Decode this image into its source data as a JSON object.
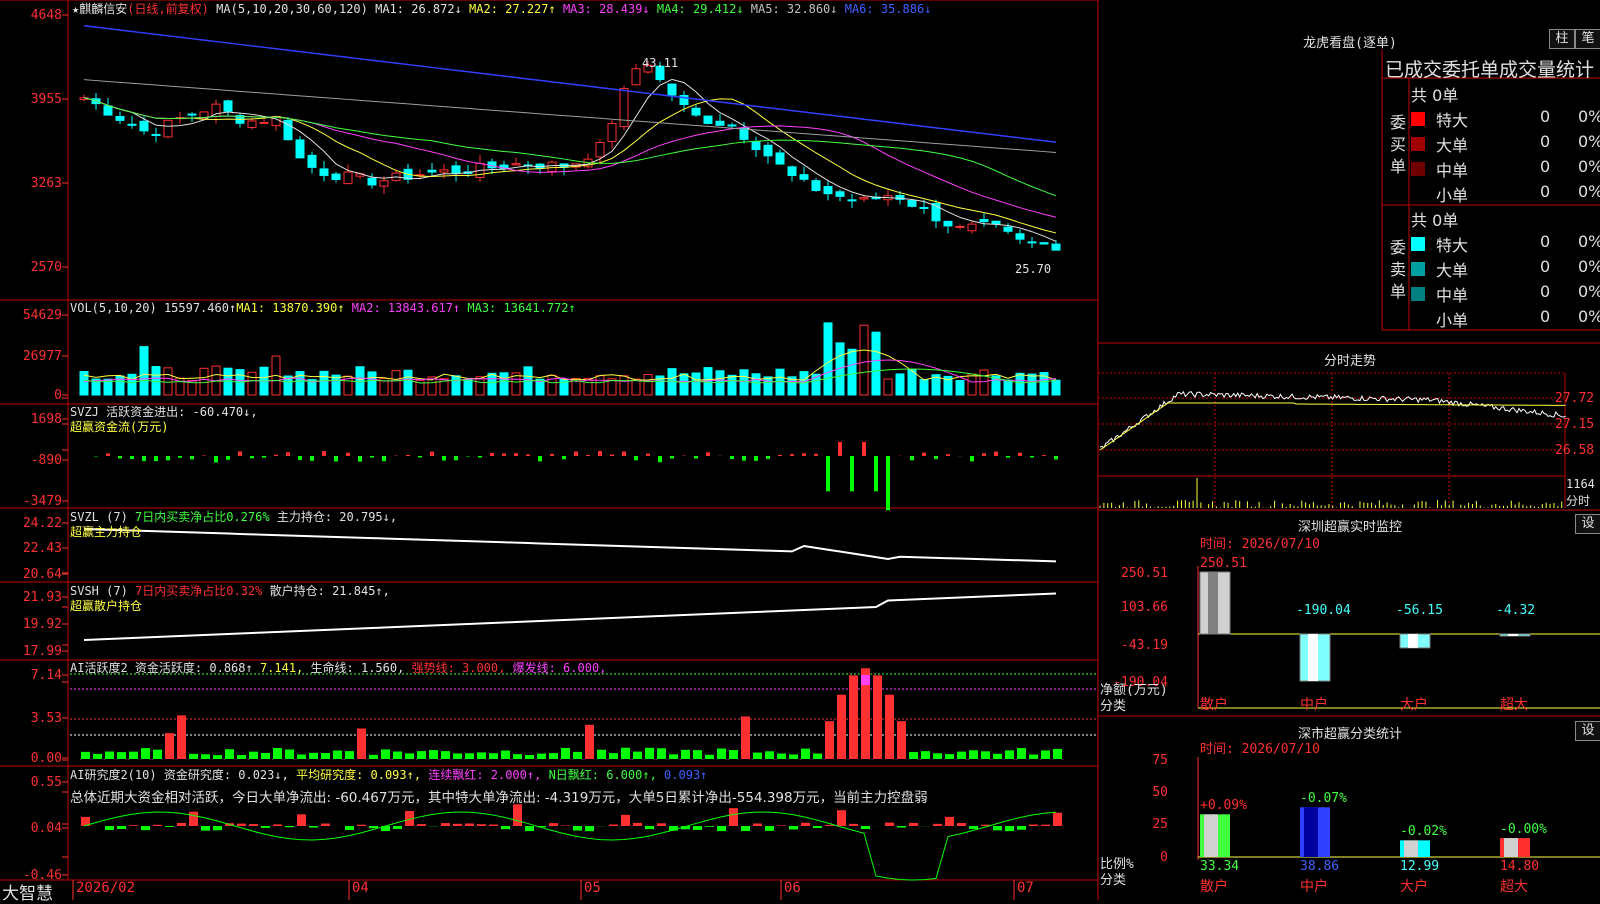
{
  "kline": {
    "title": "★麒麟信安",
    "mode": "(日线,前复权)",
    "ma_label": "MA(5,10,20,30,60,120)",
    "ma": [
      {
        "name": "MA1:",
        "value": "26.872↓",
        "color": "#e0e0e0"
      },
      {
        "name": "MA2:",
        "value": "27.227↑",
        "color": "#ffff40"
      },
      {
        "name": "MA3:",
        "value": "28.439↓",
        "color": "#ff40ff"
      },
      {
        "name": "MA4:",
        "value": "29.412↓",
        "color": "#40ff40"
      },
      {
        "name": "MA5:",
        "value": "32.860↓",
        "color": "#c0c0c0"
      },
      {
        "name": "MA6:",
        "value": "35.886↓",
        "color": "#4060ff"
      }
    ],
    "y_ticks": [
      "4648",
      "3955",
      "3263",
      "2570"
    ],
    "high_label": "43.11",
    "low_label": "25.70"
  },
  "vol": {
    "label": "VOL(5,10,20)",
    "value": "15597.460↑",
    "ma": [
      {
        "name": "MA1:",
        "value": "13870.390↑",
        "color": "#ffff40"
      },
      {
        "name": "MA2:",
        "value": "13843.617↑",
        "color": "#ff40ff"
      },
      {
        "name": "MA3:",
        "value": "13641.772↑",
        "color": "#40ff40"
      }
    ],
    "y_ticks": [
      "54629",
      "26977",
      "0"
    ]
  },
  "svzj": {
    "line1": "SVZJ  活跃资金进出: -60.470↓,",
    "line2": "超赢资金流(万元)",
    "y_ticks": [
      "1698",
      "-890",
      "-3479"
    ]
  },
  "svzl": {
    "label": "SVZL (7)",
    "ratio": "7日内买卖净占比0.276%",
    "hold": "主力持仓: 20.795↓,",
    "sub": "超赢主力持仓",
    "y_ticks": [
      "24.22",
      "22.43",
      "20.64"
    ]
  },
  "svsh": {
    "label": "SVSH (7)",
    "ratio": "7日内买卖净占比0.32%",
    "hold": "散户持仓: 21.845↑,",
    "sub": "超赢散户持仓",
    "y_ticks": [
      "21.93",
      "19.92",
      "17.99"
    ]
  },
  "ai_active": {
    "label": "AI活跃度2",
    "items": [
      {
        "text": "资金活跃度: 0.868↑",
        "color": "#e0e0e0"
      },
      {
        "text": "7.141,",
        "color": "#ffff40"
      },
      {
        "text": "生命线: 1.560,",
        "color": "#e0e0e0"
      },
      {
        "text": "强势线: 3.000,",
        "color": "#ff3030"
      },
      {
        "text": "爆发线: 6.000,",
        "color": "#ff40ff"
      }
    ],
    "y_ticks": [
      "7.14",
      "3.53",
      "0.00"
    ]
  },
  "ai_research": {
    "label": "AI研究度2(10)",
    "items": [
      {
        "text": "资金研究度: 0.023↓,",
        "color": "#e0e0e0"
      },
      {
        "text": "平均研究度: 0.093↑,",
        "color": "#ffff40"
      },
      {
        "text": "连续飘红: 2.000↑,",
        "color": "#ff40ff"
      },
      {
        "text": "N日飘红: 6.000↑,",
        "color": "#40ff40"
      },
      {
        "text": "0.093↑",
        "color": "#4060ff"
      }
    ],
    "summary": "总体近期大资金相对活跃，今日大单净流出: -60.467万元，其中特大单净流出: -4.319万元，大单5日累计净出-554.398万元，当前主力控盘弱",
    "y_ticks": [
      "0.55",
      "0.04",
      "-0.46"
    ]
  },
  "bottom": {
    "brand": "大智慧",
    "dates": [
      "2026/02",
      "04",
      "05",
      "06",
      "07"
    ]
  },
  "dragon": {
    "title": "龙虎看盘(逐单)",
    "btn_bar": "柱",
    "btn_tick": "笔",
    "header": "已成交委托单成交量统计",
    "buy_label": "委买单",
    "sell_label": "委卖单",
    "buy_total": "共 0单",
    "sell_total": "共 0单",
    "buy_rows": [
      {
        "name": "特大",
        "count": "0",
        "pct": "0%",
        "color": "#ff0000"
      },
      {
        "name": "大单",
        "count": "0",
        "pct": "0%",
        "color": "#a00000"
      },
      {
        "name": "中单",
        "count": "0",
        "pct": "0%",
        "color": "#700000"
      },
      {
        "name": "小单",
        "count": "0",
        "pct": "0%",
        "color": ""
      }
    ],
    "sell_rows": [
      {
        "name": "特大",
        "count": "0",
        "pct": "0%",
        "color": "#00ffff"
      },
      {
        "name": "大单",
        "count": "0",
        "pct": "0%",
        "color": "#00a0a0"
      },
      {
        "name": "中单",
        "count": "0",
        "pct": "0%",
        "color": "#008080"
      },
      {
        "name": "小单",
        "count": "0",
        "pct": "0%",
        "color": ""
      }
    ]
  },
  "intraday": {
    "title": "分时走势",
    "y_ticks": [
      "27.72",
      "27.15",
      "26.58"
    ],
    "vol_tick": "1164",
    "vol_label": "分时"
  },
  "monitor": {
    "title": "深圳超赢实时监控",
    "set": "设",
    "time": "时间: 2026/07/10",
    "y_ticks": [
      "250.51",
      "103.66",
      "-43.19",
      "-190.04"
    ],
    "y_label": "净额(万元)",
    "x_label": "分类",
    "bars": [
      {
        "cat": "散户",
        "value": "250.51",
        "num": 250.51
      },
      {
        "cat": "中户",
        "value": "-190.04",
        "num": -190.04
      },
      {
        "cat": "大户",
        "value": "-56.15",
        "num": -56.15
      },
      {
        "cat": "超大",
        "value": "-4.32",
        "num": -4.32
      }
    ]
  },
  "classify": {
    "title": "深市超赢分类统计",
    "set": "设",
    "time": "时间: 2026/07/10",
    "y_ticks": [
      "75",
      "50",
      "25",
      "0"
    ],
    "y_label": "比例%",
    "x_label": "分类",
    "bars": [
      {
        "cat": "散户",
        "change": "+0.09%",
        "value": "33.34",
        "num": 33.34
      },
      {
        "cat": "中户",
        "change": "-0.07%",
        "value": "38.86",
        "num": 38.86
      },
      {
        "cat": "大户",
        "change": "-0.02%",
        "value": "12.99",
        "num": 12.99
      },
      {
        "cat": "超大",
        "change": "-0.00%",
        "value": "14.80",
        "num": 14.8
      }
    ]
  }
}
